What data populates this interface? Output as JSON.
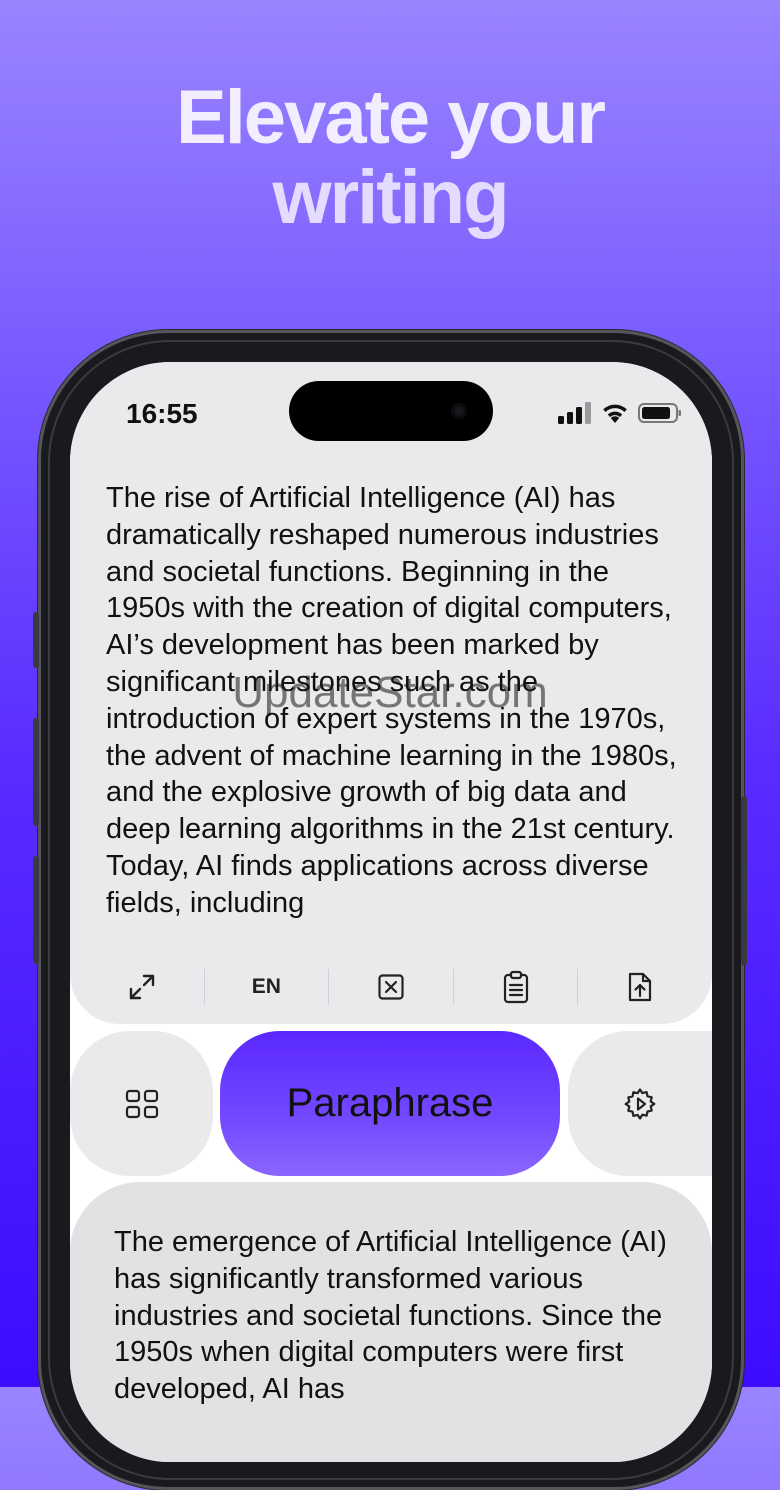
{
  "headline": {
    "line1": "Elevate your",
    "line2": "writing"
  },
  "status_bar": {
    "time": "16:55"
  },
  "input": {
    "text": "The rise of Artificial Intelligence (AI) has dramatically reshaped numerous industries and societal functions. Beginning in the 1950s with the creation of digital computers, AI’s development has been marked by significant milestones such as the introduction of expert systems in the 1970s, the advent of machine learning in the 1980s, and the explosive growth of big data and deep learning algorithms in the 21st century. Today, AI finds applications across diverse fields, including"
  },
  "toolbar": {
    "language": "EN"
  },
  "actions": {
    "paraphrase_label": "Paraphrase"
  },
  "output": {
    "text": "The emergence of Artificial Intelligence (AI) has significantly transformed various industries and societal functions. Since the 1950s when digital computers were first developed, AI has"
  },
  "watermark": "UpdateStar.com",
  "colors": {
    "accent": "#5a28ff",
    "card": "#eaeaec"
  },
  "icons": {
    "expand": "expand-icon",
    "clear": "clear-x-icon",
    "paste": "clipboard-icon",
    "upload": "file-upload-icon",
    "grid": "grid-icon",
    "settings": "gear-icon"
  }
}
